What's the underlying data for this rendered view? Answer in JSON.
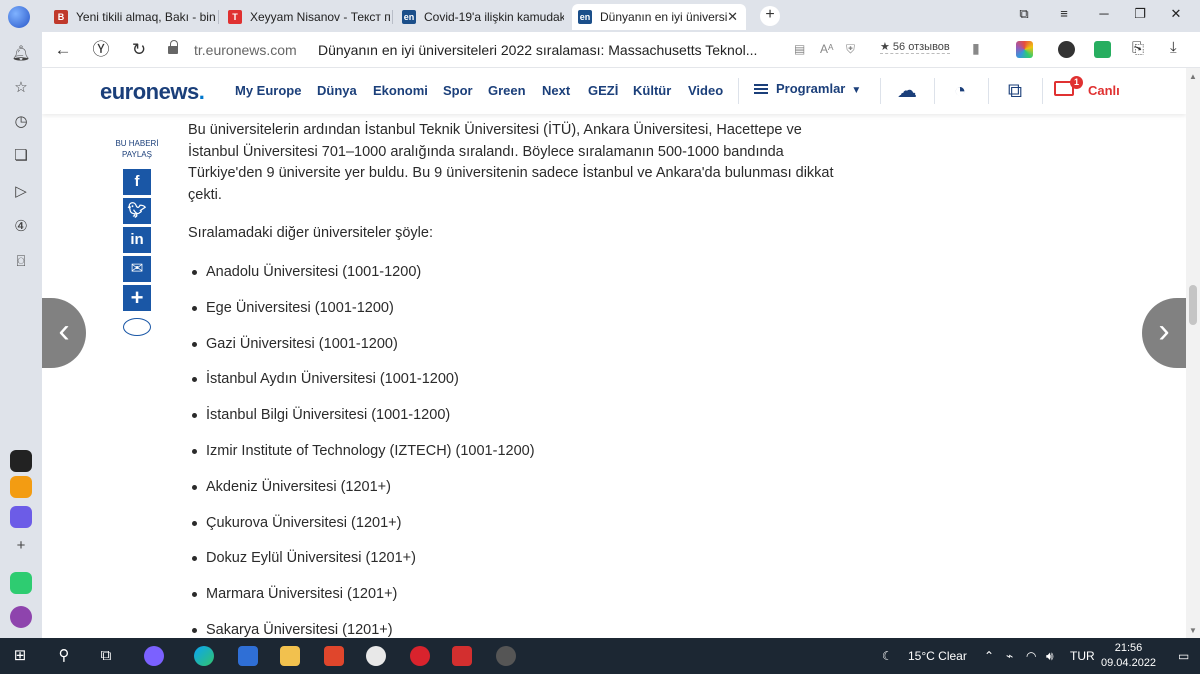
{
  "browser": {
    "tabs": [
      {
        "favicon": "B",
        "title": "Yeni tikili almaq, Bakı - bina",
        "color": "#c0392b"
      },
      {
        "favicon": "T",
        "title": "Xeyyam Nisanov - Текст пе",
        "color": "#e03131"
      },
      {
        "favicon": "en",
        "title": "Covid-19'a ilişkin kamudak",
        "color": "#1b4f8a"
      },
      {
        "favicon": "en",
        "title": "Dünyanın en iyi üniversi",
        "color": "#1b4f8a"
      }
    ],
    "active_tab_close": "✕",
    "new_tab": "+",
    "domain": "tr.euronews.com",
    "page_title": "Dünyanın en iyi üniversiteleri 2022 sıralaması: Massachusetts Teknol...",
    "reviews": "★ 56 отзывов"
  },
  "header": {
    "logo": "euronews",
    "logo_dot": ".",
    "nav": [
      "My Europe",
      "Dünya",
      "Ekonomi",
      "Spor",
      "Green",
      "Next",
      "GEZİ",
      "Kültür",
      "Video"
    ],
    "programs": "Programlar",
    "live_label": "Canlı",
    "live_badge": "1",
    "colors": {
      "brand": "#1b3f7a",
      "accent": "#0077cc",
      "live": "#e03131"
    }
  },
  "share": {
    "label_line1": "BU HABERİ",
    "label_line2": "PAYLAŞ",
    "buttons": [
      "facebook-icon",
      "twitter-icon",
      "linkedin-icon",
      "email-icon",
      "plus-icon"
    ]
  },
  "article": {
    "paragraph": "Bu üniversitelerin ardından İstanbul Teknik Üniversitesi (İTÜ), Ankara Üniversitesi, Hacettepe ve İstanbul Üniversitesi 701–1000 aralığında sıralandı. Böylece sıralamanın 500-1000 bandında Türkiye'den 9 üniversite yer buldu. Bu 9 üniversitenin sadece İstanbul ve Ankara'da bulunması dikkat çekti.",
    "lead": "Sıralamadaki diğer üniversiteler şöyle:",
    "universities": [
      "Anadolu Üniversitesi (1001-1200)",
      "Ege Üniversitesi (1001-1200)",
      "Gazi Üniversitesi (1001-1200)",
      "İstanbul Aydın Üniversitesi (1001-1200)",
      "İstanbul Bilgi Üniversitesi (1001-1200)",
      "Izmir Institute of Technology (IZTECH) (1001-1200)",
      "Akdeniz Üniversitesi (1201+)",
      "Çukurova Üniversitesi (1201+)",
      "Dokuz Eylül Üniversitesi (1201+)",
      "Marmara Üniversitesi (1201+)",
      "Sakarya Üniversitesi (1201+)"
    ]
  },
  "taskbar": {
    "weather": "15°C  Clear",
    "language": "TUR",
    "time": "21:56",
    "date": "09.04.2022"
  }
}
